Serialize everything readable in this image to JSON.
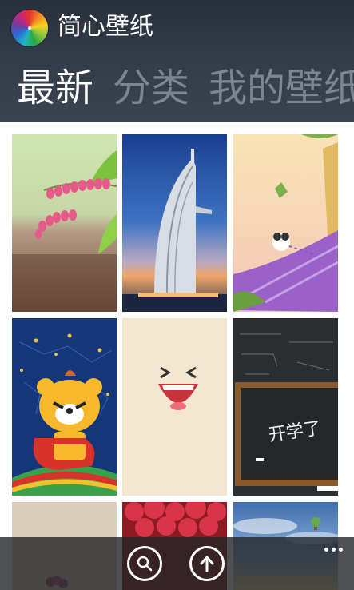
{
  "app": {
    "title": "简心壁纸",
    "logo_icon": "color-wheel-icon"
  },
  "pivot": {
    "items": [
      "最新",
      "分类",
      "我的壁纸"
    ],
    "active_index": 0
  },
  "wallpapers": [
    {
      "subject": "pink-flowers",
      "colors": [
        "#d8cab7",
        "#e65a8a",
        "#7cc23c"
      ]
    },
    {
      "subject": "burj-al-arab-at-dusk",
      "colors": [
        "#1f4fa0",
        "#e8a070",
        "#c9cfd8"
      ]
    },
    {
      "subject": "cartoon-panda-on-purple-slope",
      "colors": [
        "#f4d9a8",
        "#9a62c8",
        "#7bb04a"
      ]
    },
    {
      "subject": "cartoon-bear-hero",
      "colors": [
        "#14367a",
        "#f7b82e",
        "#d8322a"
      ]
    },
    {
      "subject": "laughing-face",
      "colors": [
        "#f3e8cf",
        "#c9333a",
        "#333333"
      ]
    },
    {
      "subject": "chalkboard-school-started",
      "colors": [
        "#2b2e31",
        "#8a5a2a",
        "#ffffff"
      ]
    },
    {
      "subject": "plain-beige-with-flowers",
      "colors": [
        "#d9cdbb",
        "#a54a6a"
      ]
    },
    {
      "subject": "red-petals",
      "colors": [
        "#c92b3a",
        "#8c1a22"
      ]
    },
    {
      "subject": "hot-air-balloon-sky",
      "colors": [
        "#4a78b6",
        "#f0d9a0"
      ]
    }
  ],
  "chalkboard_text": "开学了",
  "appbar": {
    "search_icon": "search-icon",
    "upload_icon": "upload-arrow-icon",
    "more_icon": "more-dots-icon"
  }
}
